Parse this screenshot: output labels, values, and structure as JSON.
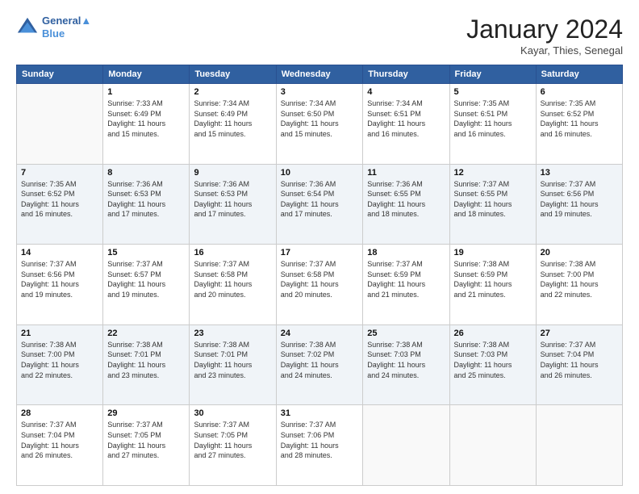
{
  "header": {
    "logo_line1": "General",
    "logo_line2": "Blue",
    "month": "January 2024",
    "location": "Kayar, Thies, Senegal"
  },
  "days_of_week": [
    "Sunday",
    "Monday",
    "Tuesday",
    "Wednesday",
    "Thursday",
    "Friday",
    "Saturday"
  ],
  "weeks": [
    [
      {
        "day": "",
        "info": []
      },
      {
        "day": "1",
        "info": [
          "Sunrise: 7:33 AM",
          "Sunset: 6:49 PM",
          "Daylight: 11 hours",
          "and 15 minutes."
        ]
      },
      {
        "day": "2",
        "info": [
          "Sunrise: 7:34 AM",
          "Sunset: 6:49 PM",
          "Daylight: 11 hours",
          "and 15 minutes."
        ]
      },
      {
        "day": "3",
        "info": [
          "Sunrise: 7:34 AM",
          "Sunset: 6:50 PM",
          "Daylight: 11 hours",
          "and 15 minutes."
        ]
      },
      {
        "day": "4",
        "info": [
          "Sunrise: 7:34 AM",
          "Sunset: 6:51 PM",
          "Daylight: 11 hours",
          "and 16 minutes."
        ]
      },
      {
        "day": "5",
        "info": [
          "Sunrise: 7:35 AM",
          "Sunset: 6:51 PM",
          "Daylight: 11 hours",
          "and 16 minutes."
        ]
      },
      {
        "day": "6",
        "info": [
          "Sunrise: 7:35 AM",
          "Sunset: 6:52 PM",
          "Daylight: 11 hours",
          "and 16 minutes."
        ]
      }
    ],
    [
      {
        "day": "7",
        "info": [
          "Sunrise: 7:35 AM",
          "Sunset: 6:52 PM",
          "Daylight: 11 hours",
          "and 16 minutes."
        ]
      },
      {
        "day": "8",
        "info": [
          "Sunrise: 7:36 AM",
          "Sunset: 6:53 PM",
          "Daylight: 11 hours",
          "and 17 minutes."
        ]
      },
      {
        "day": "9",
        "info": [
          "Sunrise: 7:36 AM",
          "Sunset: 6:53 PM",
          "Daylight: 11 hours",
          "and 17 minutes."
        ]
      },
      {
        "day": "10",
        "info": [
          "Sunrise: 7:36 AM",
          "Sunset: 6:54 PM",
          "Daylight: 11 hours",
          "and 17 minutes."
        ]
      },
      {
        "day": "11",
        "info": [
          "Sunrise: 7:36 AM",
          "Sunset: 6:55 PM",
          "Daylight: 11 hours",
          "and 18 minutes."
        ]
      },
      {
        "day": "12",
        "info": [
          "Sunrise: 7:37 AM",
          "Sunset: 6:55 PM",
          "Daylight: 11 hours",
          "and 18 minutes."
        ]
      },
      {
        "day": "13",
        "info": [
          "Sunrise: 7:37 AM",
          "Sunset: 6:56 PM",
          "Daylight: 11 hours",
          "and 19 minutes."
        ]
      }
    ],
    [
      {
        "day": "14",
        "info": [
          "Sunrise: 7:37 AM",
          "Sunset: 6:56 PM",
          "Daylight: 11 hours",
          "and 19 minutes."
        ]
      },
      {
        "day": "15",
        "info": [
          "Sunrise: 7:37 AM",
          "Sunset: 6:57 PM",
          "Daylight: 11 hours",
          "and 19 minutes."
        ]
      },
      {
        "day": "16",
        "info": [
          "Sunrise: 7:37 AM",
          "Sunset: 6:58 PM",
          "Daylight: 11 hours",
          "and 20 minutes."
        ]
      },
      {
        "day": "17",
        "info": [
          "Sunrise: 7:37 AM",
          "Sunset: 6:58 PM",
          "Daylight: 11 hours",
          "and 20 minutes."
        ]
      },
      {
        "day": "18",
        "info": [
          "Sunrise: 7:37 AM",
          "Sunset: 6:59 PM",
          "Daylight: 11 hours",
          "and 21 minutes."
        ]
      },
      {
        "day": "19",
        "info": [
          "Sunrise: 7:38 AM",
          "Sunset: 6:59 PM",
          "Daylight: 11 hours",
          "and 21 minutes."
        ]
      },
      {
        "day": "20",
        "info": [
          "Sunrise: 7:38 AM",
          "Sunset: 7:00 PM",
          "Daylight: 11 hours",
          "and 22 minutes."
        ]
      }
    ],
    [
      {
        "day": "21",
        "info": [
          "Sunrise: 7:38 AM",
          "Sunset: 7:00 PM",
          "Daylight: 11 hours",
          "and 22 minutes."
        ]
      },
      {
        "day": "22",
        "info": [
          "Sunrise: 7:38 AM",
          "Sunset: 7:01 PM",
          "Daylight: 11 hours",
          "and 23 minutes."
        ]
      },
      {
        "day": "23",
        "info": [
          "Sunrise: 7:38 AM",
          "Sunset: 7:01 PM",
          "Daylight: 11 hours",
          "and 23 minutes."
        ]
      },
      {
        "day": "24",
        "info": [
          "Sunrise: 7:38 AM",
          "Sunset: 7:02 PM",
          "Daylight: 11 hours",
          "and 24 minutes."
        ]
      },
      {
        "day": "25",
        "info": [
          "Sunrise: 7:38 AM",
          "Sunset: 7:03 PM",
          "Daylight: 11 hours",
          "and 24 minutes."
        ]
      },
      {
        "day": "26",
        "info": [
          "Sunrise: 7:38 AM",
          "Sunset: 7:03 PM",
          "Daylight: 11 hours",
          "and 25 minutes."
        ]
      },
      {
        "day": "27",
        "info": [
          "Sunrise: 7:37 AM",
          "Sunset: 7:04 PM",
          "Daylight: 11 hours",
          "and 26 minutes."
        ]
      }
    ],
    [
      {
        "day": "28",
        "info": [
          "Sunrise: 7:37 AM",
          "Sunset: 7:04 PM",
          "Daylight: 11 hours",
          "and 26 minutes."
        ]
      },
      {
        "day": "29",
        "info": [
          "Sunrise: 7:37 AM",
          "Sunset: 7:05 PM",
          "Daylight: 11 hours",
          "and 27 minutes."
        ]
      },
      {
        "day": "30",
        "info": [
          "Sunrise: 7:37 AM",
          "Sunset: 7:05 PM",
          "Daylight: 11 hours",
          "and 27 minutes."
        ]
      },
      {
        "day": "31",
        "info": [
          "Sunrise: 7:37 AM",
          "Sunset: 7:06 PM",
          "Daylight: 11 hours",
          "and 28 minutes."
        ]
      },
      {
        "day": "",
        "info": []
      },
      {
        "day": "",
        "info": []
      },
      {
        "day": "",
        "info": []
      }
    ]
  ]
}
